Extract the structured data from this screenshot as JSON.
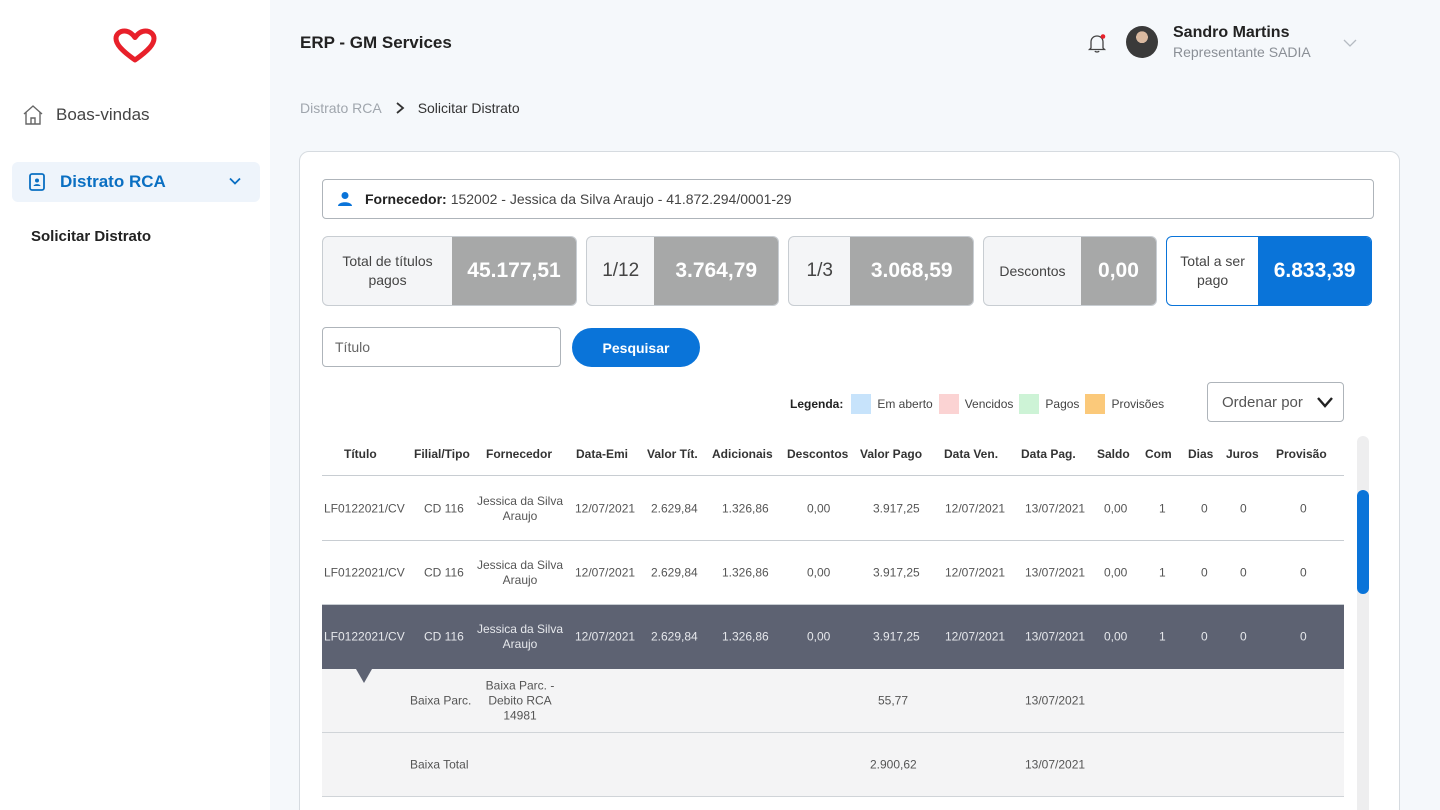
{
  "sidebar": {
    "home_label": "Boas-vindas",
    "active_label": "Distrato RCA",
    "sub_label": "Solicitar Distrato"
  },
  "header": {
    "title": "ERP - GM Services",
    "user_name": "Sandro Martins",
    "user_role": "Representante SADIA"
  },
  "breadcrumb": {
    "parent": "Distrato RCA",
    "current": "Solicitar Distrato"
  },
  "supplier": {
    "label": "Fornecedor:",
    "value": "152002 - Jessica da Silva Araujo - 41.872.294/0001-29"
  },
  "kpis": {
    "total_pagos_label": "Total de títulos pagos",
    "total_pagos_value": "45.177,51",
    "twelfth_label": "1/12",
    "twelfth_value": "3.764,79",
    "third_label": "1/3",
    "third_value": "3.068,59",
    "descontos_label": "Descontos",
    "descontos_value": "0,00",
    "total_label": "Total a ser pago",
    "total_value": "6.833,39"
  },
  "search": {
    "placeholder": "Título",
    "button": "Pesquisar"
  },
  "legend": {
    "title": "Legenda:",
    "items": [
      {
        "label": "Em aberto",
        "color": "#c7e3fb"
      },
      {
        "label": "Vencidos",
        "color": "#fbd3d3"
      },
      {
        "label": "Pagos",
        "color": "#cdf3d6"
      },
      {
        "label": "Provisões",
        "color": "#fbc97a"
      }
    ]
  },
  "order_by": "Ordenar por",
  "table": {
    "headers": [
      "Título",
      "Filial/Tipo",
      "Fornecedor",
      "Data-Emi",
      "Valor Tít.",
      "Adicionais",
      "Descontos",
      "Valor Pago",
      "Data Ven.",
      "Data Pag.",
      "Saldo",
      "Com",
      "Dias",
      "Juros",
      "Provisão"
    ],
    "rows": [
      [
        "LF0122021/CV",
        "CD 116",
        "Jessica da Silva Araujo",
        "12/07/2021",
        "2.629,84",
        "1.326,86",
        "0,00",
        "3.917,25",
        "12/07/2021",
        "13/07/2021",
        "0,00",
        "1",
        "0",
        "0",
        "0"
      ],
      [
        "LF0122021/CV",
        "CD 116",
        "Jessica da Silva Araujo",
        "12/07/2021",
        "2.629,84",
        "1.326,86",
        "0,00",
        "3.917,25",
        "12/07/2021",
        "13/07/2021",
        "0,00",
        "1",
        "0",
        "0",
        "0"
      ],
      [
        "LF0122021/CV",
        "CD 116",
        "Jessica da Silva Araujo",
        "12/07/2021",
        "2.629,84",
        "1.326,86",
        "0,00",
        "3.917,25",
        "12/07/2021",
        "13/07/2021",
        "0,00",
        "1",
        "0",
        "0",
        "0"
      ]
    ],
    "details": [
      {
        "tipo": "Baixa Parc.",
        "desc": "Baixa Parc. - Debito RCA 14981",
        "valor": "55,77",
        "data": "13/07/2021"
      },
      {
        "tipo": "Baixa Total",
        "desc": "",
        "valor": "2.900,62",
        "data": "13/07/2021"
      }
    ]
  },
  "colors": {
    "accent": "#0a74d9",
    "selected_row": "#5d6272",
    "kpi_value_bg": "#a7a8a8",
    "logo": "#e8202a"
  }
}
